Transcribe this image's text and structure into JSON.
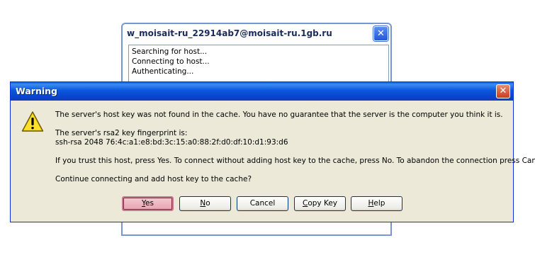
{
  "background_window": {
    "title": "w_moisait-ru_22914ab7@moisait-ru.1gb.ru",
    "close_glyph": "✕",
    "log_lines": [
      "Searching for host...",
      "Connecting to host...",
      "Authenticating..."
    ]
  },
  "dialog": {
    "title": "Warning",
    "close_glyph": "✕",
    "icon": "warning-icon",
    "messages": {
      "line1": "The server's host key was not found in the cache. You have no guarantee that the server is the computer you think it is.",
      "line2": "The server's rsa2 key fingerprint is:",
      "line3": "ssh-rsa 2048 76:4c:a1:e8:bd:3c:15:a0:88:2f:d0:df:10:d1:93:d6",
      "line4": "If you trust this host, press Yes. To connect without adding host key to the cache, press No. To abandon the connection press Cancel.",
      "line5": "Continue connecting and add host key to the cache?"
    },
    "buttons": [
      {
        "mnemonic": "Y",
        "rest": "es"
      },
      {
        "mnemonic": "N",
        "rest": "o"
      },
      {
        "mnemonic": "",
        "rest": "Cancel"
      },
      {
        "mnemonic": "C",
        "rest": "opy Key"
      },
      {
        "mnemonic": "H",
        "rest": "elp"
      }
    ]
  },
  "colors": {
    "titlebar_blue": "#0a57dc",
    "dialog_face": "#ece9d8",
    "close_red": "#c9401d",
    "default_button_pink": "#e7a5b1"
  }
}
